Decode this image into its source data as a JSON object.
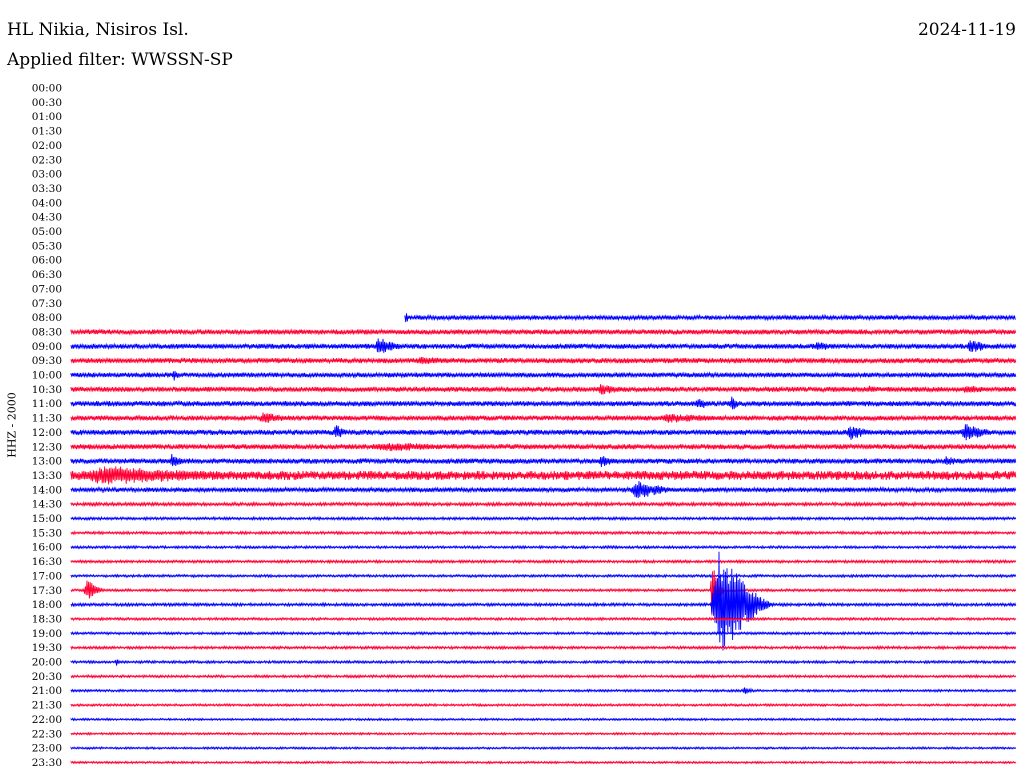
{
  "header": {
    "station": "HL Nikia, Nisiros Isl.",
    "date": "2024-11-19",
    "filter": "Applied filter: WWSSN-SP"
  },
  "chart_data": {
    "type": "line",
    "title": "HL Nikia, Nisiros Isl.",
    "subtitle": "Applied filter: WWSSN-SP",
    "date": "2024-11-19",
    "ylabel": "HHZ - 2000",
    "xlabel": "",
    "grid": false,
    "legend": "none",
    "row_labels": [
      "00:00",
      "00:30",
      "01:00",
      "01:30",
      "02:00",
      "02:30",
      "03:00",
      "03:30",
      "04:00",
      "04:30",
      "05:00",
      "05:30",
      "06:00",
      "06:30",
      "07:00",
      "07:30",
      "08:00",
      "08:30",
      "09:00",
      "09:30",
      "10:00",
      "10:30",
      "11:00",
      "11:30",
      "12:00",
      "12:30",
      "13:00",
      "13:30",
      "14:00",
      "14:30",
      "15:00",
      "15:30",
      "16:00",
      "16:30",
      "17:00",
      "17:30",
      "18:00",
      "18:30",
      "19:00",
      "19:30",
      "20:00",
      "20:30",
      "21:00",
      "21:30",
      "22:00",
      "22:30",
      "23:00",
      "23:30"
    ],
    "row_minutes": 30,
    "colors": {
      "even": "#0000ff",
      "odd": "#ff0033"
    },
    "record_start": "08:00",
    "record_start_offset_min": 10.6,
    "noise_level": [
      0,
      0,
      0,
      0,
      0,
      0,
      0,
      0,
      0,
      0,
      0,
      0,
      0,
      0,
      0,
      0,
      2.2,
      2.5,
      2.5,
      2.6,
      2.4,
      2.5,
      2.6,
      2.5,
      2.6,
      2.6,
      2.6,
      4.5,
      2.2,
      1.6,
      1.3,
      1.3,
      1.2,
      1.3,
      1.2,
      1.2,
      1.4,
      1.2,
      1.2,
      1.3,
      1.2,
      1.2,
      1.1,
      1.1,
      1.0,
      1.0,
      1.0,
      1.0
    ],
    "events": [
      {
        "row": "08:00",
        "start_min": 10.6,
        "duration_min": 0.2,
        "amp": 7
      },
      {
        "row": "09:00",
        "start_min": 9.6,
        "duration_min": 1.4,
        "amp": 9
      },
      {
        "row": "09:00",
        "start_min": 23.5,
        "duration_min": 1.5,
        "amp": 5
      },
      {
        "row": "09:00",
        "start_min": 28.4,
        "duration_min": 1.4,
        "amp": 7
      },
      {
        "row": "09:30",
        "start_min": 10.7,
        "duration_min": 3.5,
        "amp": 4
      },
      {
        "row": "10:00",
        "start_min": 3.2,
        "duration_min": 0.5,
        "amp": 6
      },
      {
        "row": "10:30",
        "start_min": 16.6,
        "duration_min": 1.8,
        "amp": 6
      },
      {
        "row": "10:30",
        "start_min": 25.1,
        "duration_min": 1.6,
        "amp": 4
      },
      {
        "row": "10:30",
        "start_min": 28.2,
        "duration_min": 1.8,
        "amp": 5
      },
      {
        "row": "11:00",
        "start_min": 19.8,
        "duration_min": 0.8,
        "amp": 7
      },
      {
        "row": "11:00",
        "start_min": 20.9,
        "duration_min": 0.5,
        "amp": 8
      },
      {
        "row": "11:30",
        "start_min": 5.9,
        "duration_min": 1.8,
        "amp": 6
      },
      {
        "row": "11:30",
        "start_min": 18.5,
        "duration_min": 4.0,
        "amp": 5
      },
      {
        "row": "12:00",
        "start_min": 8.3,
        "duration_min": 0.8,
        "amp": 8
      },
      {
        "row": "12:00",
        "start_min": 24.6,
        "duration_min": 1.2,
        "amp": 8
      },
      {
        "row": "12:00",
        "start_min": 28.2,
        "duration_min": 1.6,
        "amp": 9
      },
      {
        "row": "12:30",
        "start_min": 9.3,
        "duration_min": 5.5,
        "amp": 5
      },
      {
        "row": "13:00",
        "start_min": 3.1,
        "duration_min": 0.8,
        "amp": 8
      },
      {
        "row": "13:00",
        "start_min": 16.7,
        "duration_min": 1.1,
        "amp": 6
      },
      {
        "row": "13:00",
        "start_min": 27.6,
        "duration_min": 1.4,
        "amp": 5
      },
      {
        "row": "13:30",
        "start_min": 0.0,
        "duration_min": 8.6,
        "amp": 10
      },
      {
        "row": "14:00",
        "start_min": 17.7,
        "duration_min": 2.0,
        "amp": 10
      },
      {
        "row": "17:30",
        "start_min": 0.4,
        "duration_min": 0.8,
        "amp": 11
      },
      {
        "row": "17:30",
        "start_min": 20.3,
        "duration_min": 0.5,
        "amp": 36
      },
      {
        "row": "18:00",
        "start_min": 20.3,
        "duration_min": 2.2,
        "amp": 55
      },
      {
        "row": "20:00",
        "start_min": 1.4,
        "duration_min": 0.3,
        "amp": 4
      },
      {
        "row": "21:00",
        "start_min": 21.3,
        "duration_min": 0.6,
        "amp": 4
      }
    ]
  }
}
